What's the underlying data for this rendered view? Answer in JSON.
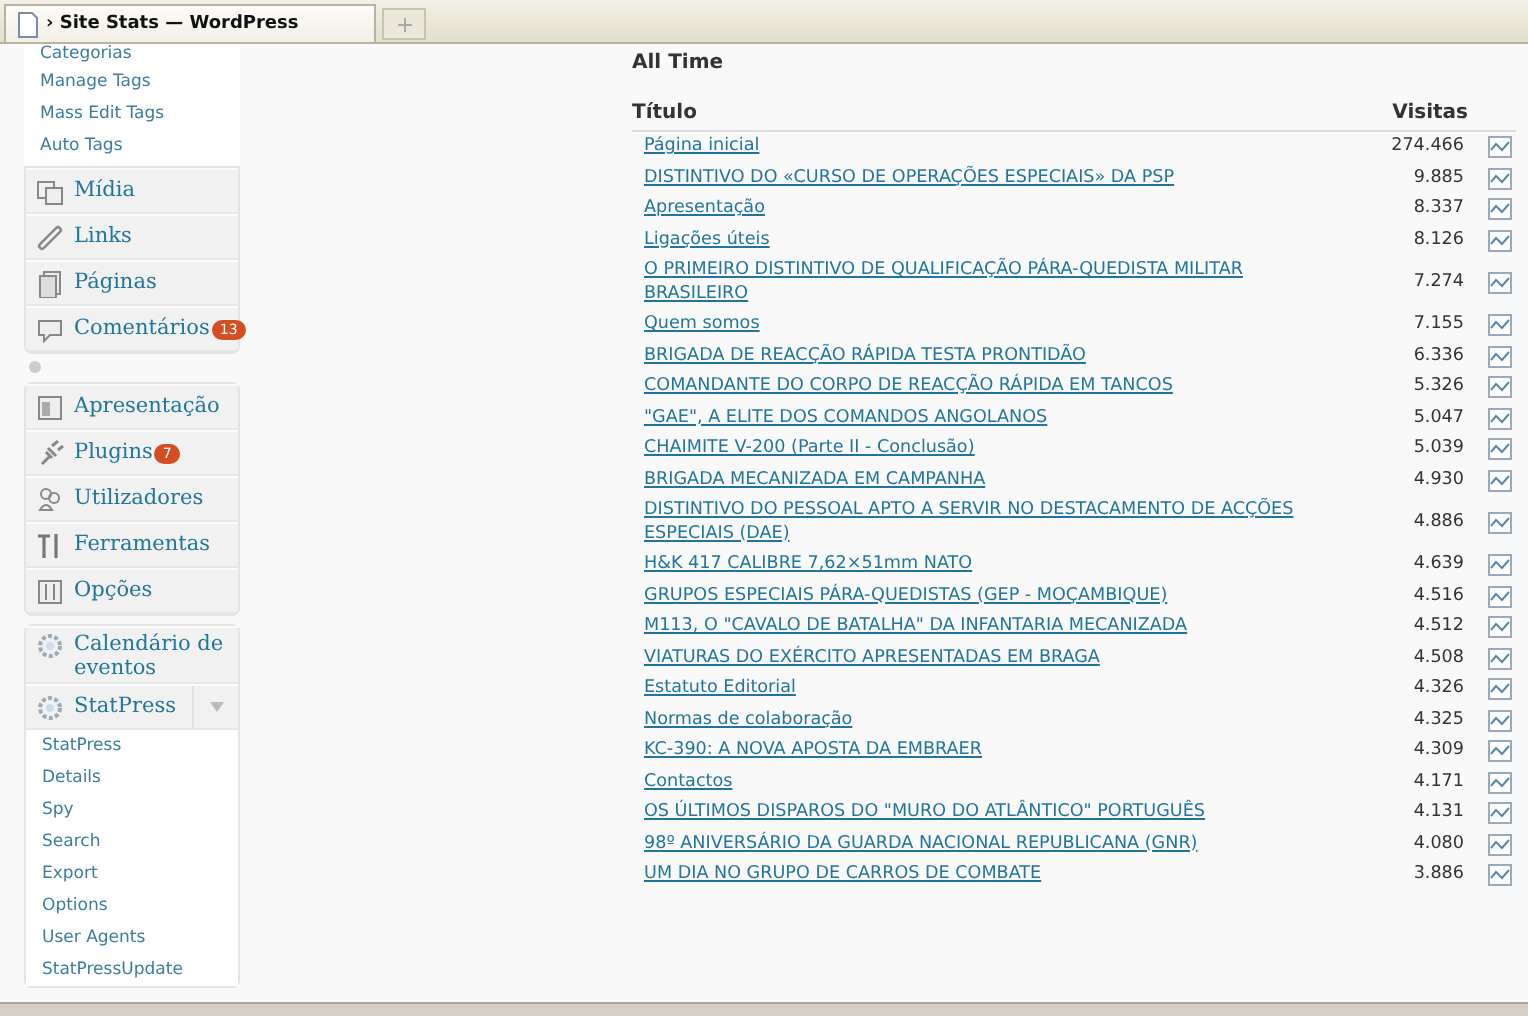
{
  "browser_tab": {
    "title": "› Site Stats — WordPress"
  },
  "sidebar": {
    "top_submenu": [
      "Categorias",
      "Manage Tags",
      "Mass Edit Tags",
      "Auto Tags"
    ],
    "group_1": [
      {
        "label": "Mídia"
      },
      {
        "label": "Links"
      },
      {
        "label": "Páginas"
      },
      {
        "label": "Comentários",
        "badge": "13"
      }
    ],
    "group_2": [
      {
        "label": "Apresentação"
      },
      {
        "label": "Plugins",
        "badge": "7"
      },
      {
        "label": "Utilizadores"
      },
      {
        "label": "Ferramentas"
      },
      {
        "label": "Opções"
      }
    ],
    "group_3": [
      {
        "label": "Calendário de eventos",
        "expanded": false
      },
      {
        "label": "StatPress",
        "expanded": true,
        "children": [
          "StatPress",
          "Details",
          "Spy",
          "Search",
          "Export",
          "Options",
          "User Agents",
          "StatPressUpdate"
        ]
      }
    ]
  },
  "main": {
    "section_title": "All Time",
    "table": {
      "columns": [
        "Título",
        "Visitas"
      ],
      "rows": [
        {
          "title": "Página inicial",
          "visits": "274.466"
        },
        {
          "title": "DISTINTIVO DO «CURSO DE OPERAÇÕES ESPECIAIS» DA PSP",
          "visits": "9.885"
        },
        {
          "title": "Apresentação",
          "visits": "8.337"
        },
        {
          "title": "Ligações úteis",
          "visits": "8.126"
        },
        {
          "title": "O PRIMEIRO DISTINTIVO DE QUALIFICAÇÃO PÁRA-QUEDISTA MILITAR BRASILEIRO",
          "visits": "7.274"
        },
        {
          "title": "Quem somos",
          "visits": "7.155"
        },
        {
          "title": "BRIGADA DE REACÇÃO RÁPIDA TESTA PRONTIDÃO",
          "visits": "6.336"
        },
        {
          "title": "COMANDANTE DO CORPO DE REACÇÃO RÁPIDA EM TANCOS",
          "visits": "5.326"
        },
        {
          "title": "\"GAE\", A ELITE DOS COMANDOS ANGOLANOS",
          "visits": "5.047"
        },
        {
          "title": "CHAIMITE V-200 (Parte II - Conclusão)",
          "visits": "5.039"
        },
        {
          "title": "BRIGADA MECANIZADA EM CAMPANHA",
          "visits": "4.930"
        },
        {
          "title": "DISTINTIVO DO PESSOAL APTO A SERVIR NO DESTACAMENTO DE ACÇÕES ESPECIAIS (DAE)",
          "visits": "4.886"
        },
        {
          "title": "H&K 417 CALIBRE 7,62×51mm NATO",
          "visits": "4.639"
        },
        {
          "title": "GRUPOS ESPECIAIS PÁRA-QUEDISTAS (GEP - MOÇAMBIQUE)",
          "visits": "4.516"
        },
        {
          "title": "M113, O \"CAVALO DE BATALHA\" DA INFANTARIA MECANIZADA",
          "visits": "4.512"
        },
        {
          "title": "VIATURAS DO EXÉRCITO APRESENTADAS EM BRAGA",
          "visits": "4.508"
        },
        {
          "title": "Estatuto Editorial",
          "visits": "4.326"
        },
        {
          "title": "Normas de colaboração",
          "visits": "4.325"
        },
        {
          "title": "KC-390: A NOVA APOSTA DA EMBRAER",
          "visits": "4.309"
        },
        {
          "title": "Contactos",
          "visits": "4.171"
        },
        {
          "title": "OS ÚLTIMOS DISPAROS DO \"MURO DO ATLÂNTICO\" PORTUGUÊS",
          "visits": "4.131"
        },
        {
          "title": "98º ANIVERSÁRIO DA GUARDA NACIONAL REPUBLICANA (GNR)",
          "visits": "4.080"
        },
        {
          "title": "UM DIA NO GRUPO DE CARROS DE COMBATE",
          "visits": "3.886"
        }
      ]
    }
  }
}
